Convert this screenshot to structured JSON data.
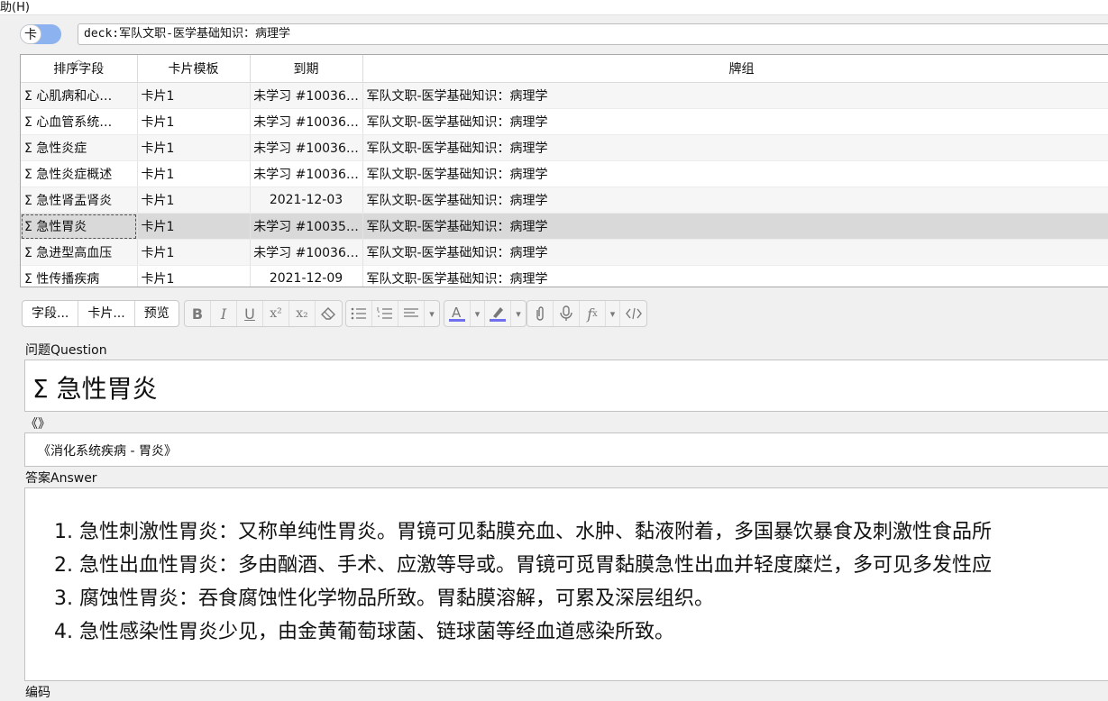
{
  "menu": {
    "help_label": "助(H)"
  },
  "search": {
    "toggle_label": "卡",
    "value": "deck:军队文职-医学基础知识：病理学"
  },
  "table": {
    "columns": [
      "排序字段",
      "卡片模板",
      "到期",
      "牌组"
    ],
    "rows": [
      {
        "sort": "Σ 心肌病和心…",
        "template": "卡片1",
        "due": "未学习 #10036…",
        "deck": "军队文职-医学基础知识：病理学"
      },
      {
        "sort": "Σ 心血管系统…",
        "template": "卡片1",
        "due": "未学习 #10036…",
        "deck": "军队文职-医学基础知识：病理学"
      },
      {
        "sort": "Σ 急性炎症",
        "template": "卡片1",
        "due": "未学习 #10036…",
        "deck": "军队文职-医学基础知识：病理学"
      },
      {
        "sort": "Σ 急性炎症概述",
        "template": "卡片1",
        "due": "未学习 #10036…",
        "deck": "军队文职-医学基础知识：病理学"
      },
      {
        "sort": "Σ 急性肾盂肾炎",
        "template": "卡片1",
        "due": "2021-12-03",
        "deck": "军队文职-医学基础知识：病理学"
      },
      {
        "sort": "Σ 急性胃炎",
        "template": "卡片1",
        "due": "未学习 #10035…",
        "deck": "军队文职-医学基础知识：病理学",
        "selected": true
      },
      {
        "sort": "Σ 急进型高血压",
        "template": "卡片1",
        "due": "未学习 #10036…",
        "deck": "军队文职-医学基础知识：病理学"
      },
      {
        "sort": "Σ 性传播疾病",
        "template": "卡片1",
        "due": "2021-12-09",
        "deck": "军队文职-医学基础知识：病理学"
      }
    ]
  },
  "editor_toolbar": {
    "fields_button": "字段...",
    "cards_button": "卡片...",
    "preview_button": "预览",
    "bold": "B",
    "italic": "I",
    "underline": "U",
    "superscript": "x²",
    "subscript": "x₂",
    "dropdown": "▾",
    "icons": [
      "eraser-icon",
      "bullet-list-icon",
      "numbered-list-icon",
      "align-icon",
      "text-color-icon",
      "highlight-icon",
      "attach-icon",
      "microphone-icon",
      "math-icon",
      "html-editor-icon"
    ],
    "accent_color": "#6f6ff0"
  },
  "fields": {
    "question_label": "问题Question",
    "question_value": "Σ 急性胃炎",
    "source_label": "《》",
    "source_value": "《消化系统疾病 - 胃炎》",
    "answer_label": "答案Answer",
    "answers": [
      "急性刺激性胃炎：又称单纯性胃炎。胃镜可见黏膜充血、水肿、黏液附着，多国暴饮暴食及刺激性食品所",
      "急性出血性胃炎：多由酗酒、手术、应激等导或。胃镜可觅胃黏膜急性出血并轻度糜烂，多可见多发性应",
      "腐蚀性胃炎：吞食腐蚀性化学物品所致。胃黏膜溶解，可累及深层组织。",
      "急性感染性胃炎少见，由金黄葡萄球菌、链球菌等经血道感染所致。"
    ],
    "next_label": "编码"
  }
}
